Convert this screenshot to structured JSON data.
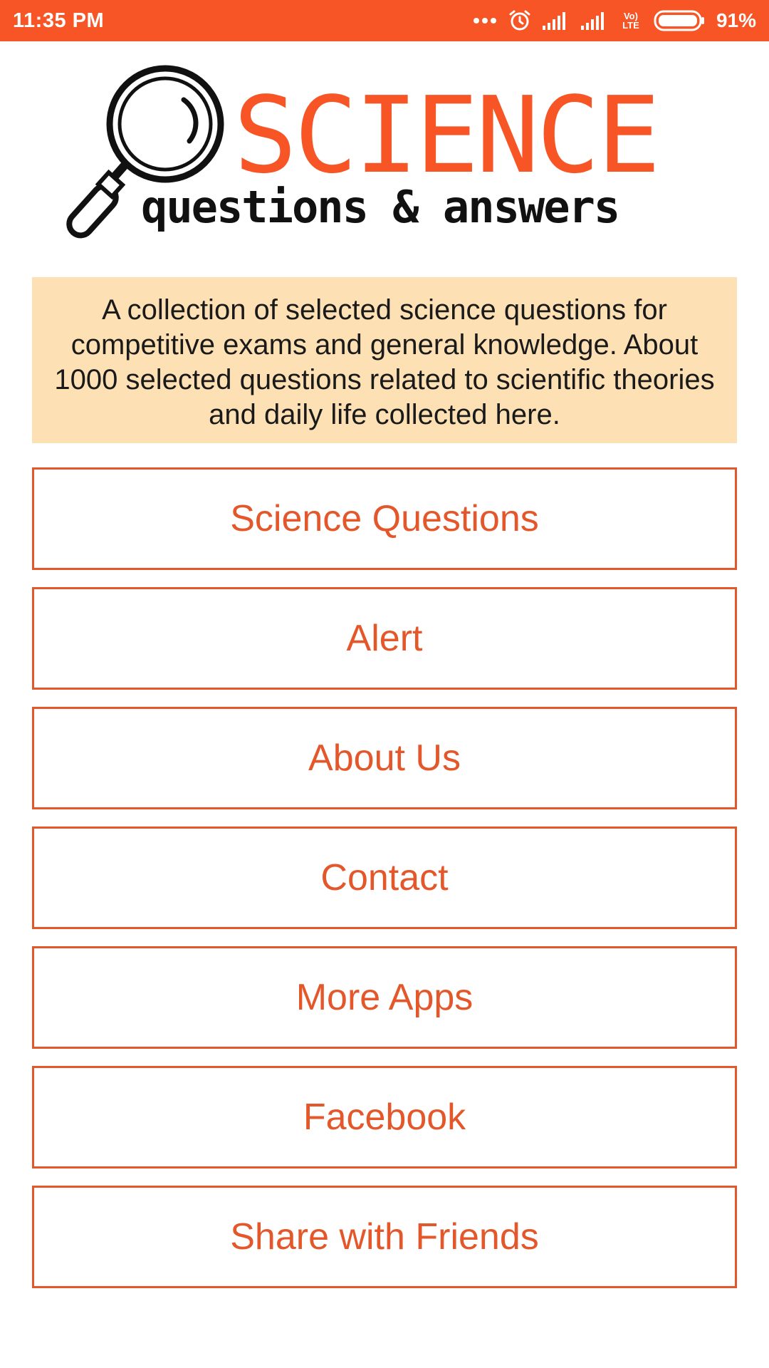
{
  "status_bar": {
    "time": "11:35 PM",
    "network_type": "Vo) LTE",
    "battery_percent": "91%",
    "icons": [
      "more-dots-icon",
      "alarm-icon",
      "signal-icon",
      "signal-icon",
      "volte-icon",
      "battery-icon"
    ]
  },
  "logo": {
    "title": "SCIENCE",
    "subtitle": "questions & answers",
    "icon": "magnifying-glass-icon"
  },
  "description": "A collection of selected science questions for competitive exams and general knowledge. About 1000 selected questions related to scientific theories and daily life collected here.",
  "menu": [
    {
      "label": "Science Questions"
    },
    {
      "label": "Alert"
    },
    {
      "label": "About Us"
    },
    {
      "label": "Contact"
    },
    {
      "label": "More Apps"
    },
    {
      "label": "Facebook"
    },
    {
      "label": "Share with Friends"
    }
  ],
  "colors": {
    "accent": "#f75525",
    "button_border": "#e4572a",
    "description_bg": "#fde0b3"
  }
}
